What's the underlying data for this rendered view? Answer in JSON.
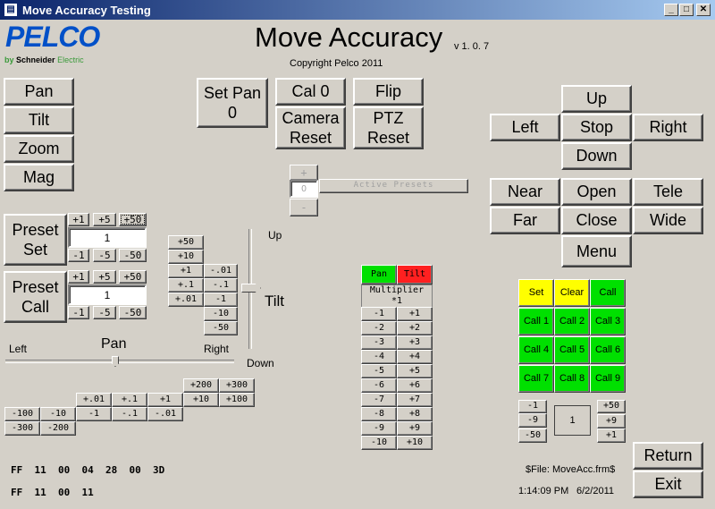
{
  "window": {
    "title": "Move Accuracy Testing",
    "min": "_",
    "max": "□",
    "close": "✕"
  },
  "logo": {
    "brand": "PELCO",
    "by": "by",
    "company": "Schneider",
    "company2": "Electric"
  },
  "header": {
    "title": "Move Accuracy",
    "version": "v 1. 0. 7",
    "copyright": "Copyright Pelco 2011"
  },
  "mode_buttons": [
    "Pan",
    "Tilt",
    "Zoom",
    "Mag"
  ],
  "top_buttons": {
    "set_pan": "Set Pan\n0",
    "cal0": "Cal 0",
    "flip": "Flip",
    "camera_reset": "Camera\nReset",
    "ptz_reset": "PTZ\nReset"
  },
  "presets_spinner": {
    "plus": "+",
    "minus": "-",
    "value": "0",
    "label": "Active Presets"
  },
  "preset_set": {
    "label": "Preset\nSet",
    "inc": [
      "+1",
      "+5",
      "+50"
    ],
    "dec": [
      "-1",
      "-5",
      "-50"
    ],
    "value": "1"
  },
  "preset_call": {
    "label": "Preset\nCall",
    "inc": [
      "+1",
      "+5",
      "+50"
    ],
    "dec": [
      "-1",
      "-5",
      "-50"
    ],
    "value": "1"
  },
  "tilt_steps": {
    "left": [
      "+50",
      "+10",
      "+1",
      "+.1",
      "+.01"
    ],
    "right": [
      "-.01",
      "-.1",
      "-1",
      "-10",
      "-50"
    ]
  },
  "tilt_slider": {
    "up": "Up",
    "down": "Down",
    "label": "Tilt"
  },
  "pan_slider": {
    "label": "Pan",
    "left": "Left",
    "right": "Right"
  },
  "pan_steps": {
    "row1": [
      "+200",
      "+300"
    ],
    "row2": [
      "+.01",
      "+.1",
      "+1",
      "+10",
      "+100"
    ],
    "row3": [
      "-100",
      "-10",
      "-1",
      "-.1",
      "-.01"
    ],
    "row4": [
      "-300",
      "-200"
    ]
  },
  "multiplier": {
    "pan": "Pan",
    "tilt": "Tilt",
    "label": "Multiplier",
    "value": "*1",
    "minus": [
      "-1",
      "-2",
      "-3",
      "-4",
      "-5",
      "-6",
      "-7",
      "-8",
      "-9",
      "-10"
    ],
    "plus": [
      "+1",
      "+2",
      "+3",
      "+4",
      "+5",
      "+6",
      "+7",
      "+8",
      "+9",
      "+10"
    ]
  },
  "direction_pad": {
    "up": "Up",
    "left": "Left",
    "stop": "Stop",
    "right": "Right",
    "down": "Down"
  },
  "lens": {
    "near": "Near",
    "open": "Open",
    "tele": "Tele",
    "far": "Far",
    "close": "Close",
    "wide": "Wide",
    "menu": "Menu"
  },
  "pattern": {
    "set": "Set",
    "clear": "Clear",
    "call": "Call",
    "calls": [
      "Call 1",
      "Call 2",
      "Call 3",
      "Call 4",
      "Call 5",
      "Call 6",
      "Call 7",
      "Call 8",
      "Call 9"
    ]
  },
  "pattern_spinner": {
    "minus": [
      "-1",
      "-9",
      "-50"
    ],
    "plus": [
      "+50",
      "+9",
      "+1"
    ],
    "value": "1"
  },
  "footer": {
    "cmd1": "FF  11  00  04  28  00  3D",
    "cmd2": "FF  11  00  11",
    "file": "$File: MoveAcc.frm$",
    "time": "1:14:09 PM",
    "date": "6/2/2011",
    "return": "Return",
    "exit": "Exit"
  },
  "colors": {
    "green": "#00e000",
    "yellow": "#ffff00",
    "red": "#ff2020",
    "face": "#d4d0c8"
  }
}
